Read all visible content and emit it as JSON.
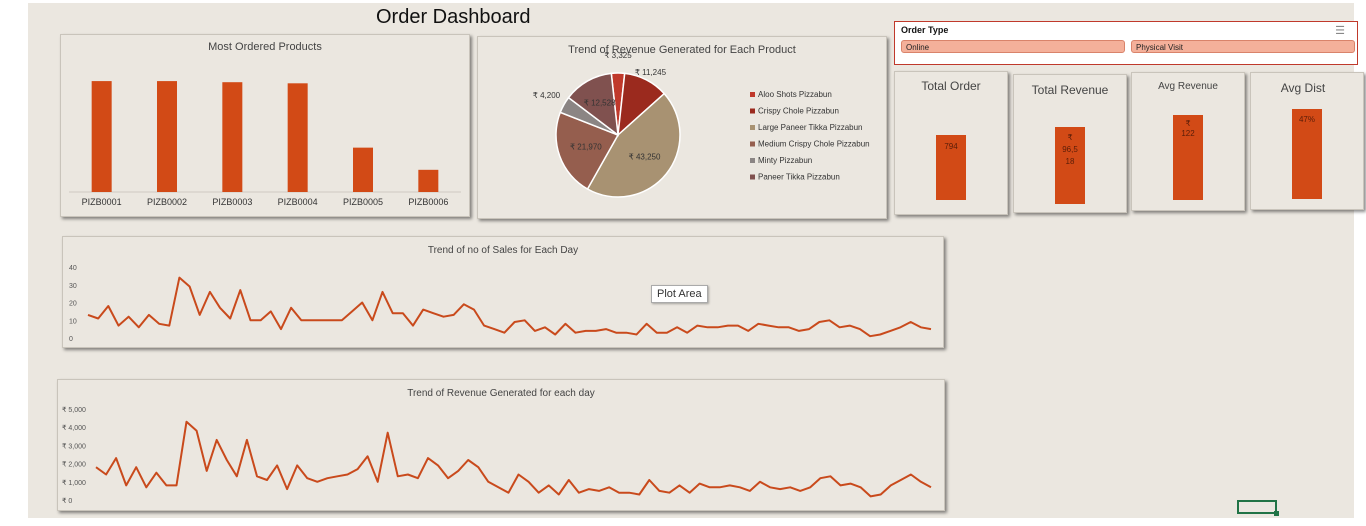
{
  "dashboard": {
    "title": "Order Dashboard"
  },
  "slicer": {
    "header": "Order Type",
    "options": [
      "Online",
      "Physical Visit"
    ],
    "filter_icon": "filter-icon"
  },
  "kpis": [
    {
      "title": "Total Order",
      "value": "794"
    },
    {
      "title": "Total Revenue",
      "value_lines": [
        "₹",
        "96,5",
        "18"
      ]
    },
    {
      "title": "Avg Revenue",
      "value_lines": [
        "₹",
        "122"
      ]
    },
    {
      "title": "Avg Dist",
      "value": "47%"
    }
  ],
  "tooltip": {
    "label": "Plot Area"
  },
  "colors": {
    "accent": "#d24a16",
    "background": "#ebe7e0",
    "line": "#c94a1c"
  },
  "chart_data": [
    {
      "type": "bar",
      "title": "Most Ordered Products",
      "categories": [
        "PIZB0001",
        "PIZB0002",
        "PIZB0003",
        "PIZB0004",
        "PIZB0005",
        "PIZB0006"
      ],
      "values": [
        100,
        100,
        99,
        98,
        40,
        20
      ],
      "ylim": [
        0,
        110
      ],
      "grid": false
    },
    {
      "type": "pie",
      "title": "Trend of Revenue Generated for Each Product",
      "categories": [
        "Aloo Shots Pizzabun",
        "Crispy Chole Pizzabun",
        "Large Paneer Tikka Pizzabun",
        "Medium Crispy Chole Pizzabun",
        "Minty Pizzabun",
        "Paneer Tikka Pizzabun"
      ],
      "values": [
        3325,
        11245,
        43250,
        21970,
        4200,
        12528
      ],
      "data_labels": [
        "₹ 3,325",
        "₹ 11,245",
        "₹ 43,250",
        "₹ 21,970",
        "₹ 4,200",
        "₹ 12,528"
      ],
      "colors": [
        "#c0392b",
        "#9b2a1e",
        "#a89272",
        "#955e4e",
        "#8b8584",
        "#80514f"
      ],
      "legend": "right"
    },
    {
      "type": "line",
      "title": "Trend of no of Sales for Each Day",
      "ylim": [
        0,
        40
      ],
      "yticks": [
        "0",
        "10",
        "20",
        "30",
        "40"
      ],
      "values": [
        13,
        11,
        18,
        7,
        12,
        6,
        13,
        8,
        7,
        34,
        29,
        13,
        26,
        17,
        11,
        27,
        10,
        10,
        15,
        5,
        17,
        10,
        10,
        10,
        10,
        10,
        15,
        20,
        10,
        26,
        14,
        14,
        7,
        16,
        14,
        12,
        13,
        19,
        16,
        7,
        5,
        3,
        9,
        10,
        4,
        6,
        2,
        8,
        3,
        4,
        4,
        5,
        3,
        3,
        2,
        8,
        3,
        3,
        6,
        3,
        7,
        6,
        6,
        7,
        7,
        4,
        8,
        7,
        6,
        6,
        4,
        5,
        9,
        10,
        6,
        7,
        5,
        1,
        2,
        4,
        6,
        9,
        6,
        5
      ]
    },
    {
      "type": "line",
      "title": "Trend of Revenue Generated for each day",
      "ylim": [
        0,
        5000
      ],
      "yticks": [
        "₹ 0",
        "₹ 1,000",
        "₹ 2,000",
        "₹ 3,000",
        "₹ 4,000",
        "₹ 5,000"
      ],
      "values": [
        1800,
        1400,
        2300,
        800,
        1800,
        700,
        1500,
        800,
        800,
        4300,
        3800,
        1600,
        3300,
        2200,
        1300,
        3300,
        1300,
        1100,
        1900,
        600,
        1900,
        1200,
        1000,
        1200,
        1300,
        1400,
        1700,
        2400,
        1000,
        3700,
        1300,
        1400,
        1200,
        2300,
        1900,
        1200,
        1600,
        2200,
        1800,
        1000,
        700,
        400,
        1400,
        1000,
        400,
        800,
        300,
        1100,
        400,
        600,
        500,
        700,
        400,
        400,
        300,
        1100,
        500,
        400,
        800,
        400,
        900,
        700,
        700,
        800,
        700,
        500,
        1000,
        700,
        600,
        700,
        500,
        700,
        1200,
        1300,
        800,
        900,
        700,
        200,
        300,
        800,
        1100,
        1400,
        1000,
        700
      ]
    }
  ]
}
